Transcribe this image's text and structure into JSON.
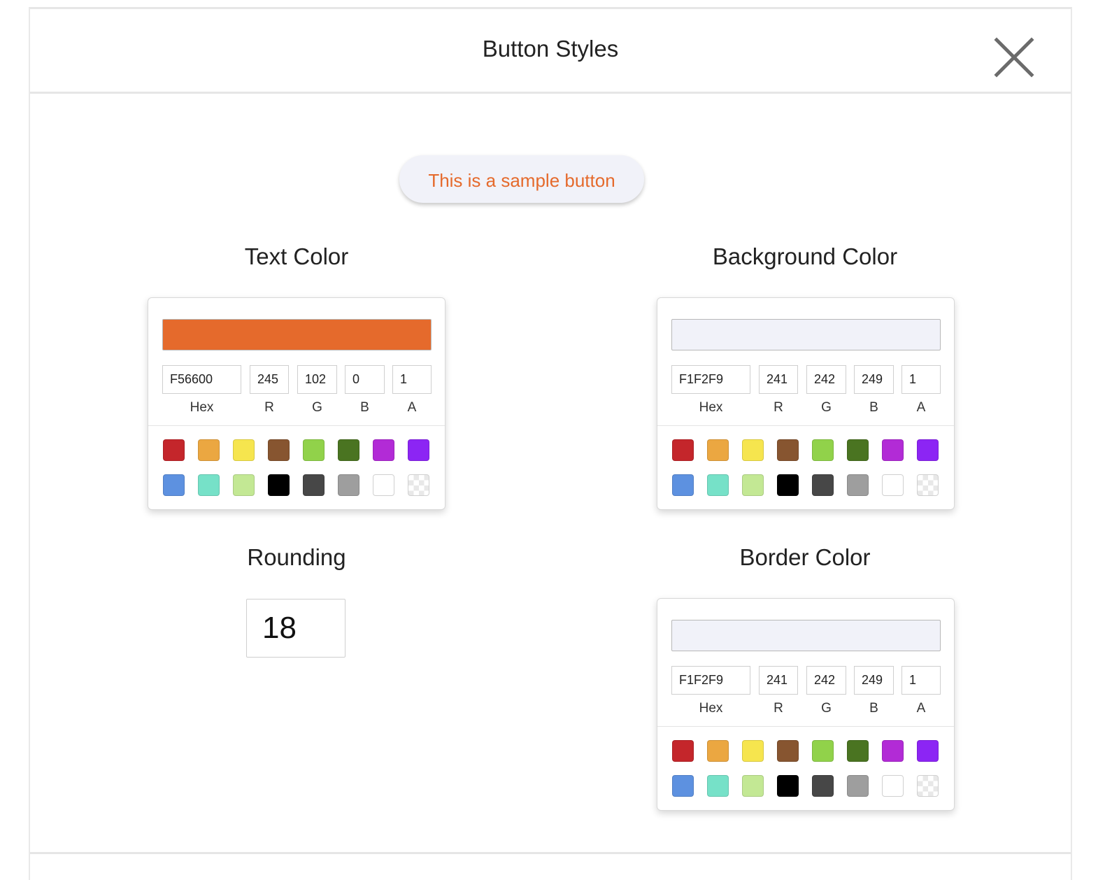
{
  "modal": {
    "title": "Button Styles"
  },
  "sample_button": {
    "label": "This is a sample button",
    "text_color": "#E56A2C",
    "background_color": "#F1F2F9"
  },
  "sections": {
    "text_color": "Text Color",
    "background_color": "Background Color",
    "rounding": "Rounding",
    "border_color": "Border Color"
  },
  "field_labels": {
    "hex": "Hex",
    "r": "R",
    "g": "G",
    "b": "B",
    "a": "A"
  },
  "pickers": {
    "text": {
      "swatch": "#E56A2C",
      "hex": "F56600",
      "r": "245",
      "g": "102",
      "b": "0",
      "a": "1"
    },
    "background": {
      "swatch": "#F1F2F9",
      "hex": "F1F2F9",
      "r": "241",
      "g": "242",
      "b": "249",
      "a": "1"
    },
    "border": {
      "swatch": "#F1F2F9",
      "hex": "F1F2F9",
      "r": "241",
      "g": "242",
      "b": "249",
      "a": "1"
    }
  },
  "rounding": {
    "value": "18"
  },
  "preset_colors": [
    "#C4262B",
    "#EBA741",
    "#F6E54E",
    "#875530",
    "#91D24A",
    "#4A7421",
    "#B22BD6",
    "#8C25F4",
    "#5D91E0",
    "#76E1C8",
    "#C3E894",
    "#000000",
    "#474747",
    "#9E9E9E",
    "#FFFFFF",
    "transparent"
  ]
}
